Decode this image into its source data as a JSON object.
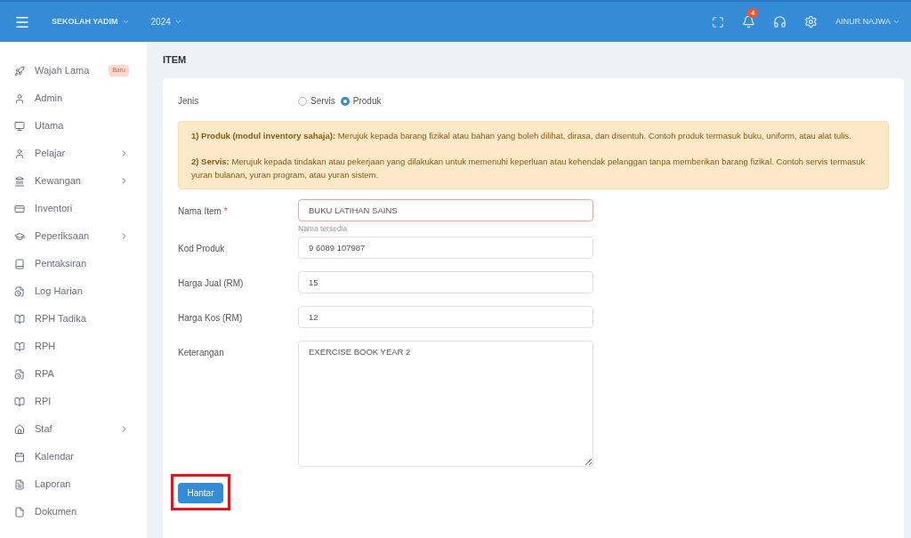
{
  "topbar": {
    "school": "SEKOLAH YADIM",
    "year": "2024",
    "notifications": "4",
    "user": "AINUR NAJWA"
  },
  "sidebar": {
    "items": [
      {
        "label": "Wajah Lama",
        "badge": "Baru",
        "has_children": false
      },
      {
        "label": "Admin",
        "has_children": false
      },
      {
        "label": "Utama",
        "has_children": false
      },
      {
        "label": "Pelajar",
        "has_children": true
      },
      {
        "label": "Kewangan",
        "has_children": true
      },
      {
        "label": "Inventori",
        "has_children": false
      },
      {
        "label": "Peperiksaan",
        "has_children": true
      },
      {
        "label": "Pentaksiran",
        "has_children": false
      },
      {
        "label": "Log Harian",
        "has_children": false
      },
      {
        "label": "RPH Tadika",
        "has_children": false
      },
      {
        "label": "RPH",
        "has_children": false
      },
      {
        "label": "RPA",
        "has_children": false
      },
      {
        "label": "RPI",
        "has_children": false
      },
      {
        "label": "Staf",
        "has_children": true
      },
      {
        "label": "Kalendar",
        "has_children": false
      },
      {
        "label": "Laporan",
        "has_children": false
      },
      {
        "label": "Dokumen",
        "has_children": false
      }
    ]
  },
  "page": {
    "title": "ITEM"
  },
  "form": {
    "type_label": "Jenis",
    "type_options": [
      {
        "label": "Servis",
        "selected": false
      },
      {
        "label": "Produk",
        "selected": true
      }
    ],
    "notice": [
      "**1) Produk (modul inventory sahaja):** Merujuk kepada barang fizikal atau bahan yang boleh dilihat, dirasa, dan disentuh. Contoh produk termasuk buku, uniform, atau alat tulis.",
      "**2) Servis:** Merujuk kepada tindakan atau pekerjaan yang dilakukan untuk memenuhi keperluan atau kehendak pelanggan tanpa memberikan barang fizikal. Contoh servis termasuk yuran bulanan, yuran program, atau yuran sistem."
    ],
    "fields": [
      {
        "kind": "input",
        "label": "Nama Item",
        "required_mark": "*",
        "value": "BUKU LATIHAN SAINS",
        "error": true,
        "help": "Nama tersedia"
      },
      {
        "kind": "input",
        "label": "Kod Produk",
        "value": "9 6089 107987",
        "error": false
      },
      {
        "kind": "input",
        "label": "Harga Jual (RM)",
        "value": "15",
        "error": false
      },
      {
        "kind": "input",
        "label": "Harga Kos (RM)",
        "value": "12",
        "error": false
      },
      {
        "kind": "textarea",
        "label": "Keterangan",
        "value": "EXERCISE BOOK YEAR 2",
        "error": false
      }
    ],
    "submit": {
      "label": "Hantar",
      "highlighted": true
    }
  }
}
